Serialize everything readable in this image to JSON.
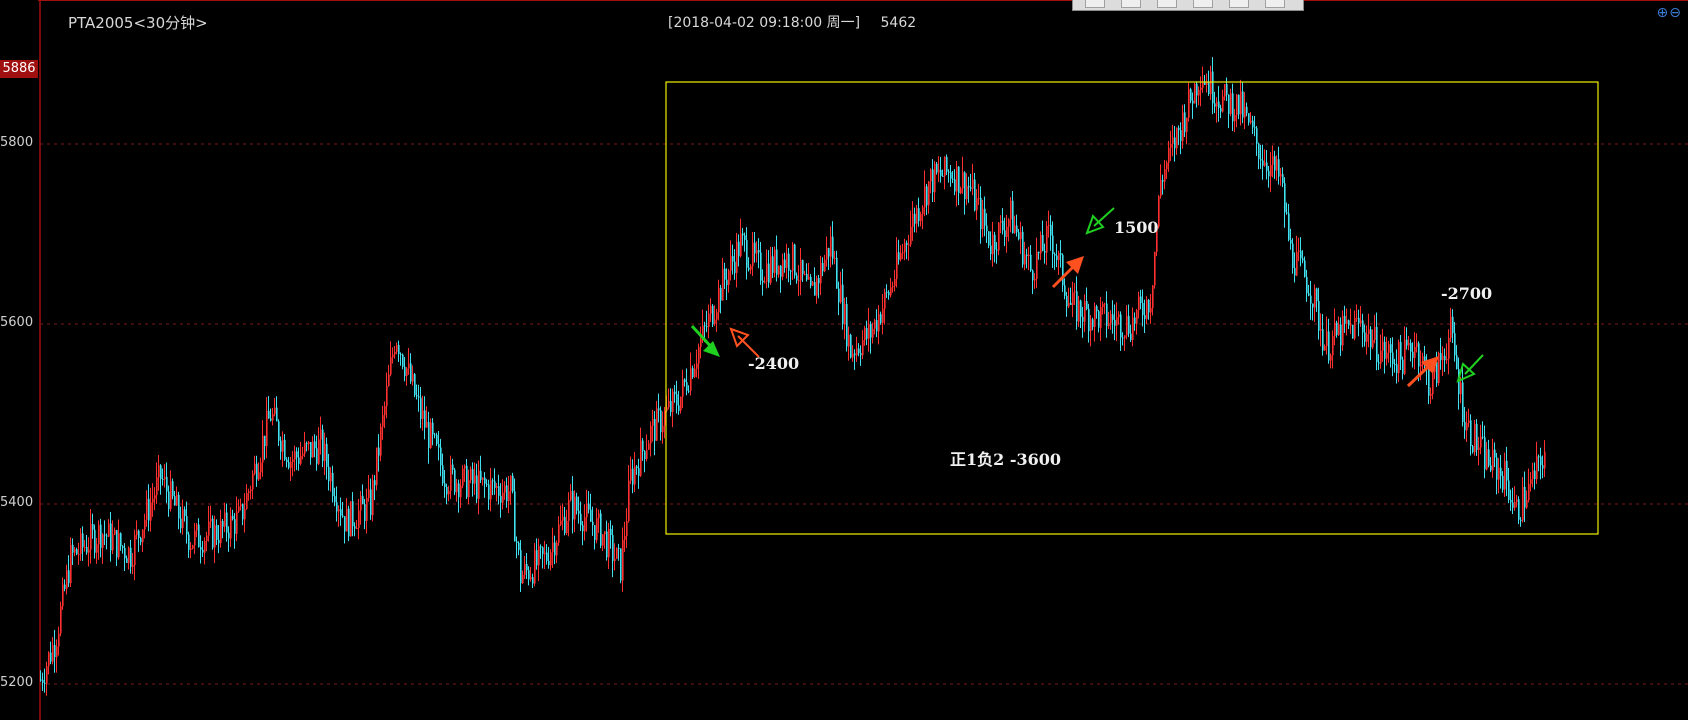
{
  "window": {
    "symbol": "PTA2005<30分钟>",
    "cursor_time": "[2018-04-02  09:18:00 周一]",
    "cursor_price": "5462"
  },
  "current_price_tag": "5886",
  "colors": {
    "up": "#ff3030",
    "down": "#40e0f0",
    "box": "#f0f000",
    "grid": "#7a1a1a",
    "arrow_red": "#ff5020",
    "arrow_green": "#20d020",
    "axis_line": "#a01010"
  },
  "chart_data": {
    "type": "candlestick",
    "title": "PTA2005<30分钟>",
    "ylim": [
      5160,
      5960
    ],
    "y_ticks": [
      5200,
      5400,
      5600,
      5800
    ],
    "grid": "dashed horizontal",
    "price_path": [
      [
        0,
        5205
      ],
      [
        15,
        5250
      ],
      [
        30,
        5340
      ],
      [
        60,
        5370
      ],
      [
        90,
        5345
      ],
      [
        120,
        5430
      ],
      [
        150,
        5360
      ],
      [
        180,
        5370
      ],
      [
        200,
        5385
      ],
      [
        230,
        5500
      ],
      [
        250,
        5450
      ],
      [
        280,
        5465
      ],
      [
        305,
        5380
      ],
      [
        330,
        5400
      ],
      [
        355,
        5590
      ],
      [
        380,
        5500
      ],
      [
        405,
        5430
      ],
      [
        440,
        5420
      ],
      [
        470,
        5415
      ],
      [
        480,
        5320
      ],
      [
        505,
        5340
      ],
      [
        530,
        5400
      ],
      [
        560,
        5370
      ],
      [
        580,
        5330
      ],
      [
        590,
        5430
      ],
      [
        610,
        5480
      ],
      [
        640,
        5520
      ],
      [
        660,
        5580
      ],
      [
        680,
        5640
      ],
      [
        700,
        5690
      ],
      [
        720,
        5660
      ],
      [
        750,
        5675
      ],
      [
        770,
        5630
      ],
      [
        790,
        5690
      ],
      [
        810,
        5570
      ],
      [
        830,
        5590
      ],
      [
        850,
        5640
      ],
      [
        870,
        5710
      ],
      [
        890,
        5760
      ],
      [
        910,
        5770
      ],
      [
        930,
        5750
      ],
      [
        950,
        5690
      ],
      [
        970,
        5720
      ],
      [
        990,
        5660
      ],
      [
        1010,
        5700
      ],
      [
        1030,
        5620
      ],
      [
        1050,
        5610
      ],
      [
        1070,
        5605
      ],
      [
        1090,
        5600
      ],
      [
        1110,
        5630
      ],
      [
        1120,
        5760
      ],
      [
        1140,
        5820
      ],
      [
        1160,
        5880
      ],
      [
        1180,
        5850
      ],
      [
        1200,
        5840
      ],
      [
        1220,
        5790
      ],
      [
        1240,
        5760
      ],
      [
        1250,
        5680
      ],
      [
        1270,
        5640
      ],
      [
        1285,
        5575
      ],
      [
        1300,
        5590
      ],
      [
        1320,
        5600
      ],
      [
        1340,
        5570
      ],
      [
        1360,
        5560
      ],
      [
        1375,
        5580
      ],
      [
        1390,
        5530
      ],
      [
        1410,
        5590
      ],
      [
        1425,
        5490
      ],
      [
        1445,
        5450
      ],
      [
        1465,
        5430
      ],
      [
        1475,
        5390
      ],
      [
        1490,
        5420
      ],
      [
        1505,
        5460
      ]
    ],
    "box": {
      "from_index_note": "trade region",
      "price_high": 5863,
      "price_low": 5368
    },
    "annotations": [
      {
        "text": "-2400"
      },
      {
        "text": "1500"
      },
      {
        "text": "-2700"
      },
      {
        "text": "正1负2  -3600"
      }
    ]
  }
}
